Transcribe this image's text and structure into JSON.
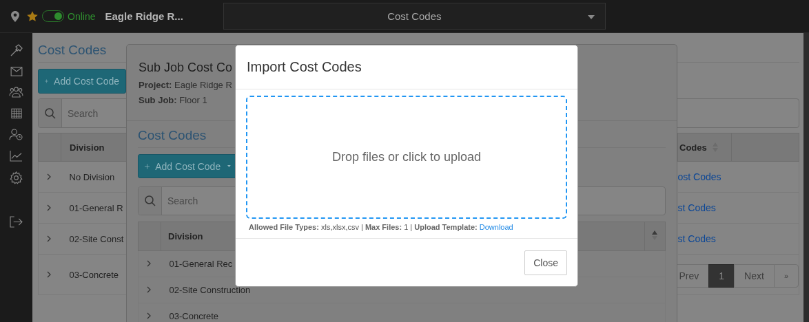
{
  "topbar": {
    "online_toggle": {
      "on": true
    },
    "status": "Online",
    "project": "Eagle Ridge R...",
    "view_select": "Cost Codes"
  },
  "page": {
    "title": "Cost Codes",
    "add_button": "Add Cost Code",
    "search_placeholder": "Search",
    "columns": [
      "Division",
      "Codes"
    ],
    "rows": [
      {
        "division": "No Division",
        "codes_link": "ost Codes"
      },
      {
        "division": "01-General R",
        "codes_link": "st Codes"
      },
      {
        "division": "02-Site Const",
        "codes_link": "st Codes"
      },
      {
        "division": "03-Concrete"
      }
    ],
    "pagination": [
      {
        "label": "Prev",
        "selected": false,
        "disabled": true
      },
      {
        "label": "1",
        "selected": true,
        "disabled": false
      },
      {
        "label": "Next",
        "selected": false,
        "disabled": true
      },
      {
        "label": "»",
        "selected": false,
        "disabled": true
      }
    ]
  },
  "sub_job_dialog": {
    "title": "Sub Job Cost Co",
    "project": "**Project:** Eagle Ridge R",
    "sub_job": "**Sub Job:** Floor 1",
    "section_title": "Cost Codes",
    "add_button": "Add Cost Code",
    "search_placeholder": "Search",
    "columns": [
      "Division"
    ],
    "rows": [
      "01-General Rec",
      "02-Site Construction",
      "03-Concrete"
    ]
  },
  "import_dialog": {
    "title": "Import Cost Codes",
    "dropzone_text": "Drop files or click to upload",
    "info": "**Allowed File Types:** xls,xlsx,csv | **Max Files:** 1 | **Upload Template:**",
    "template_link": "Download",
    "close_button": "Close"
  }
}
